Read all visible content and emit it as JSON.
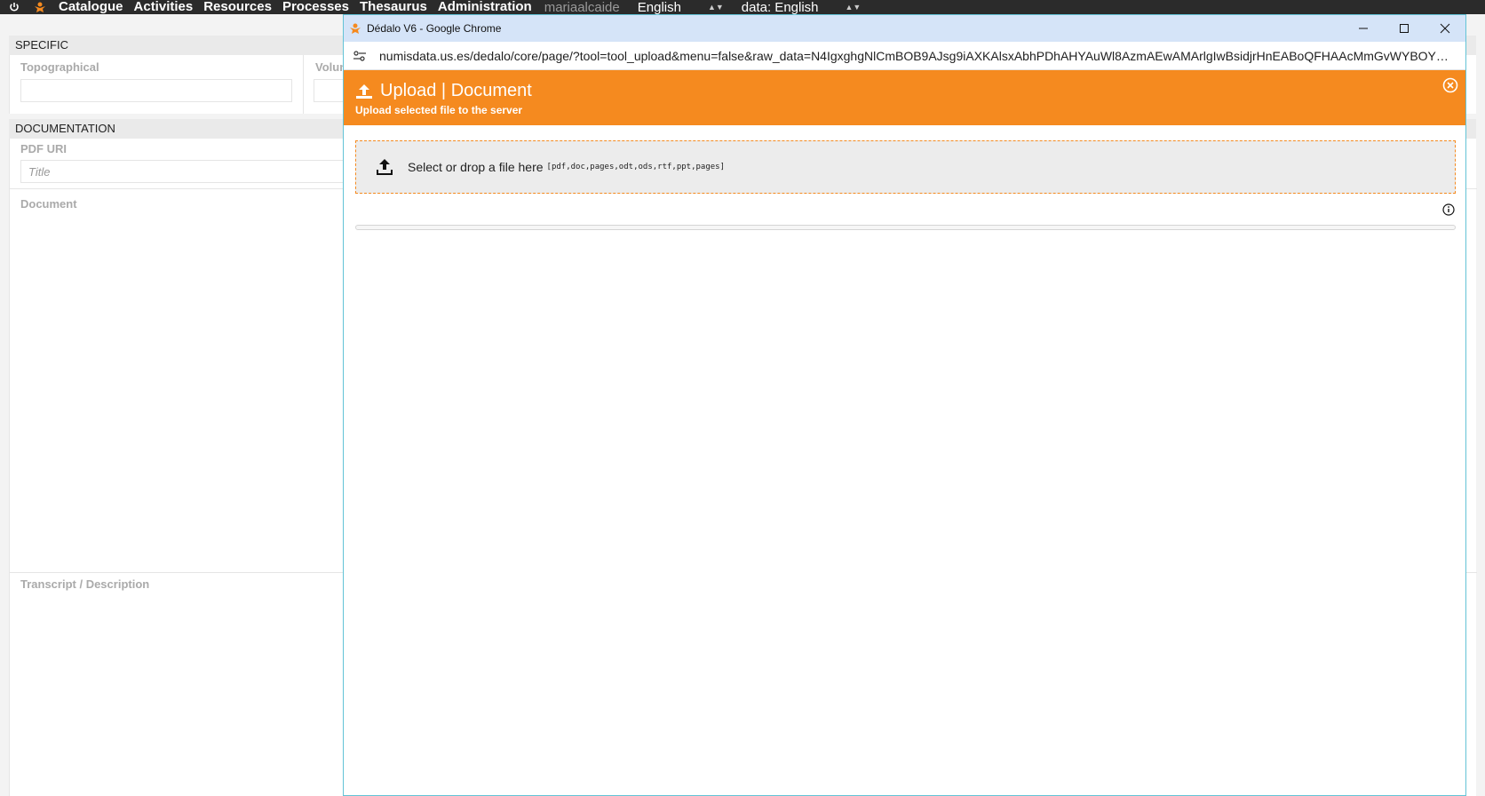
{
  "topnav": {
    "items": [
      "Catalogue",
      "Activities",
      "Resources",
      "Processes",
      "Thesaurus",
      "Administration"
    ],
    "user": "mariaalcaide",
    "language": "English",
    "data_language": "data: English"
  },
  "background": {
    "specific": {
      "header": "SPECIFIC",
      "topographical_label": "Topographical",
      "volume_label": "Volun"
    },
    "documentation": {
      "header": "DOCUMENTATION",
      "pdf_uri_label": "PDF URI",
      "title_placeholder": "Title",
      "document_label": "Document",
      "transcript_label": "Transcript / Description"
    }
  },
  "popup": {
    "window_title": "Dédalo V6 - Google Chrome",
    "url": "numisdata.us.es/dedalo/core/page/?tool=tool_upload&menu=false&raw_data=N4IgxghgNlCmBOB9AJsg9iAXKAlsxAbhPDhAHYAuWl8AzmAEwAMArlgIwBsidjrHnEABoQFHAAcMmGvWYBOYSFq...",
    "header_title": "Upload | Document",
    "header_subtitle": "Upload selected file to the server",
    "dropzone_text": "Select or drop a file here",
    "dropzone_extensions": "[pdf,doc,pages,odt,ods,rtf,ppt,pages]",
    "progress": 0
  },
  "colors": {
    "accent": "#f58a1f",
    "nav_bg": "#2b2b2b",
    "titlebar_bg": "#d5e4f8"
  }
}
